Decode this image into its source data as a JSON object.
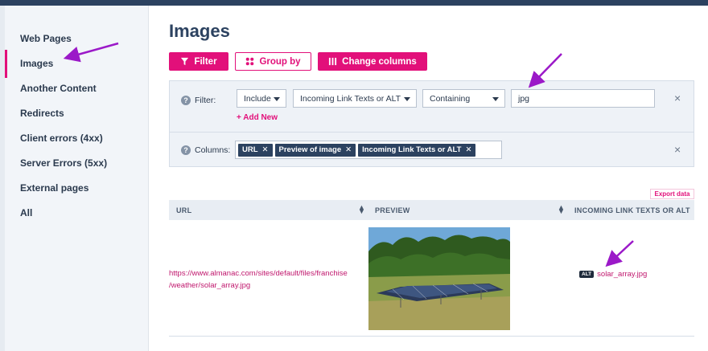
{
  "sidebar": {
    "items": [
      {
        "label": "Web Pages",
        "active": false
      },
      {
        "label": "Images",
        "active": true
      },
      {
        "label": "Another Content",
        "active": false
      },
      {
        "label": "Redirects",
        "active": false
      },
      {
        "label": "Client errors (4xx)",
        "active": false
      },
      {
        "label": "Server Errors (5xx)",
        "active": false
      },
      {
        "label": "External pages",
        "active": false
      },
      {
        "label": "All",
        "active": false
      }
    ]
  },
  "page": {
    "title": "Images"
  },
  "toolbar": {
    "filter_label": "Filter",
    "group_by_label": "Group by",
    "change_columns_label": "Change columns"
  },
  "filter_panel": {
    "label": "Filter:",
    "include_value": "Include",
    "field_value": "Incoming Link Texts or ALT",
    "operator_value": "Containing",
    "search_value": "jpg",
    "add_new_label": "+ Add New"
  },
  "columns_panel": {
    "label": "Columns:",
    "chips": [
      "URL",
      "Preview of image",
      "Incoming Link Texts or ALT"
    ]
  },
  "table": {
    "export_label": "Export data",
    "headers": [
      "URL",
      "PREVIEW",
      "INCOMING LINK TEXTS OR ALT"
    ],
    "rows": [
      {
        "url_line1": "https://www.almanac.com/sites/default/files/franchise",
        "url_line2": "/weather/solar_array.jpg",
        "preview_icon": "solar-panel-photo",
        "alt_badge": "ALT",
        "alt_text": "solar_array.jpg"
      }
    ]
  },
  "colors": {
    "accent": "#e2107a",
    "navy": "#2c4260",
    "annotation_arrow": "#9b19c8"
  }
}
